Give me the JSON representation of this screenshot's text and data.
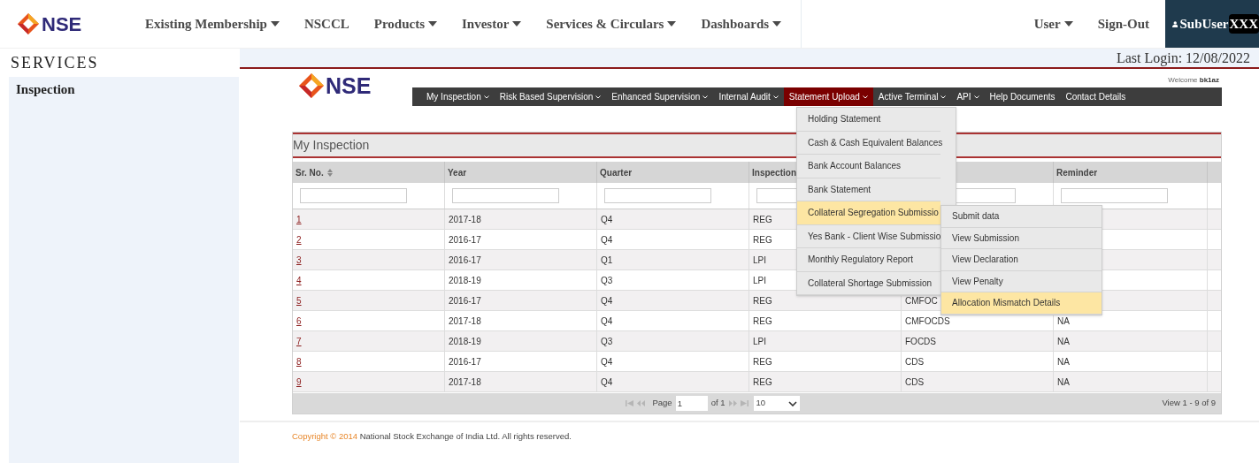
{
  "top_nav": {
    "brand": "NSE",
    "items": [
      {
        "label": "Existing Membership",
        "dropdown": true
      },
      {
        "label": "NSCCL",
        "dropdown": false
      },
      {
        "label": "Products",
        "dropdown": true
      },
      {
        "label": "Investor",
        "dropdown": true
      },
      {
        "label": "Services & Circulars",
        "dropdown": true
      },
      {
        "label": "Dashboards",
        "dropdown": true
      }
    ],
    "user_items": [
      {
        "label": "User",
        "dropdown": true
      },
      {
        "label": "Sign-Out",
        "dropdown": false
      }
    ],
    "account": {
      "label": "SubUser",
      "redacted": "XXX"
    }
  },
  "sidebar": {
    "title": "SERVICES",
    "items": [
      {
        "label": "Inspection"
      }
    ]
  },
  "status_bar": {
    "last_login": "Last Login: 12/08/2022"
  },
  "app": {
    "brand": "NSE",
    "welcome": {
      "label": "Welcome",
      "user": "bk1az"
    },
    "menu": [
      {
        "label": "My Inspection",
        "dropdown": true,
        "selected": false
      },
      {
        "label": "Risk Based Supervision",
        "dropdown": true,
        "selected": false
      },
      {
        "label": "Enhanced Supervision",
        "dropdown": true,
        "selected": false
      },
      {
        "label": "Internal Audit",
        "dropdown": true,
        "selected": false
      },
      {
        "label": "Statement Upload",
        "dropdown": true,
        "selected": true
      },
      {
        "label": "Active Terminal",
        "dropdown": true,
        "selected": false
      },
      {
        "label": "API",
        "dropdown": true,
        "selected": false
      },
      {
        "label": "Help Documents",
        "dropdown": false,
        "selected": false
      },
      {
        "label": "Contact Details",
        "dropdown": false,
        "selected": false
      }
    ],
    "dropdown": [
      {
        "label": "Holding Statement",
        "selected": false
      },
      {
        "label": "Cash & Cash Equivalent Balances",
        "selected": false
      },
      {
        "label": "Bank Account Balances",
        "selected": false
      },
      {
        "label": "Bank Statement",
        "selected": false
      },
      {
        "label": "Collateral Segregation Submissio",
        "selected": true
      },
      {
        "label": "Yes Bank - Client Wise Submissio",
        "selected": false
      },
      {
        "label": "Monthly Regulatory Report",
        "selected": false
      },
      {
        "label": "Collateral Shortage Submission",
        "selected": false
      }
    ],
    "submenu": [
      {
        "label": "Submit data",
        "selected": false
      },
      {
        "label": "View Submission",
        "selected": false
      },
      {
        "label": "View Declaration",
        "selected": false
      },
      {
        "label": "View Penalty",
        "selected": false
      },
      {
        "label": "Allocation Mismatch Details",
        "selected": true
      }
    ]
  },
  "grid": {
    "title": "My Inspection",
    "columns": [
      {
        "label": "Sr. No.",
        "sortable": true
      },
      {
        "label": "Year"
      },
      {
        "label": "Quarter"
      },
      {
        "label": "Inspection"
      },
      {},
      {
        "label": "Reminder"
      }
    ],
    "rows": [
      {
        "cells": [
          "1",
          "2017-18",
          "Q4",
          "REG",
          null,
          null
        ]
      },
      {
        "cells": [
          "2",
          "2016-17",
          "Q4",
          "REG",
          null,
          null
        ]
      },
      {
        "cells": [
          "3",
          "2016-17",
          "Q1",
          "LPI",
          null,
          null
        ]
      },
      {
        "cells": [
          "4",
          "2018-19",
          "Q3",
          "LPI",
          null,
          null
        ]
      },
      {
        "cells": [
          "5",
          "2016-17",
          "Q4",
          "REG",
          "CMFOC",
          null
        ]
      },
      {
        "cells": [
          "6",
          "2017-18",
          "Q4",
          "REG",
          "CMFOCDS",
          "NA"
        ]
      },
      {
        "cells": [
          "7",
          "2018-19",
          "Q3",
          "LPI",
          "FOCDS",
          "NA"
        ]
      },
      {
        "cells": [
          "8",
          "2016-17",
          "Q4",
          "REG",
          "CDS",
          "NA"
        ]
      },
      {
        "cells": [
          "9",
          "2017-18",
          "Q4",
          "REG",
          "CDS",
          "NA"
        ]
      }
    ],
    "pager": {
      "page_label": "Page",
      "page_value": "1",
      "of_label": "of 1",
      "page_size": "10",
      "view": "View 1 - 9 of 9"
    }
  },
  "footer": {
    "copyright": "Copyright © 2014",
    "text": "National Stock Exchange of India Ltd. All rights reserved."
  }
}
